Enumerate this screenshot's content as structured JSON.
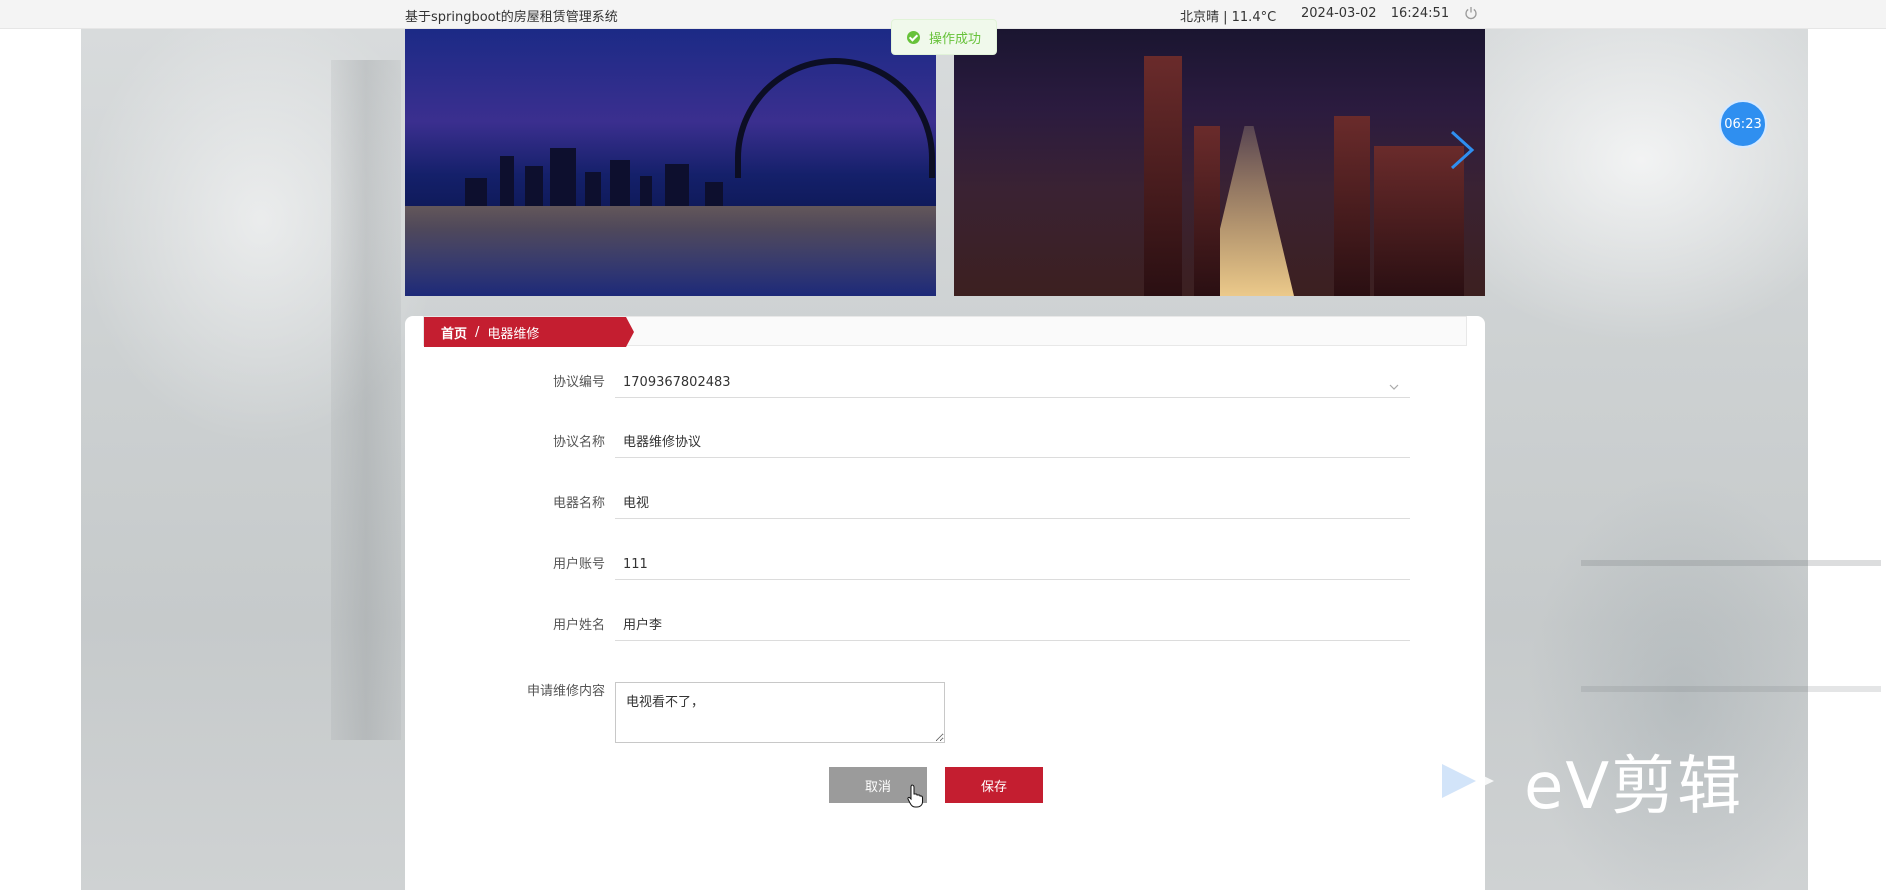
{
  "header": {
    "site_title": "基于springboot的房屋租赁管理系统",
    "weather": "北京晴 | 11.4°C",
    "date": "2024-03-02",
    "time": "16:24:51"
  },
  "toast": {
    "message": "操作成功"
  },
  "timer": {
    "value": "06:23"
  },
  "breadcrumb": {
    "home": "首页",
    "separator": "/",
    "current": "电器维修"
  },
  "form": {
    "agreement_no": {
      "label": "协议编号",
      "value": "1709367802483"
    },
    "agreement_name": {
      "label": "协议名称",
      "value": "电器维修协议"
    },
    "appliance_name": {
      "label": "电器名称",
      "value": "电视"
    },
    "user_account": {
      "label": "用户账号",
      "value": "111"
    },
    "user_name": {
      "label": "用户姓名",
      "value": "用户李"
    },
    "repair_content": {
      "label": "申请维修内容",
      "value": "电视看不了，"
    }
  },
  "buttons": {
    "cancel": "取消",
    "save": "保存"
  },
  "watermark": {
    "text": "eV剪辑"
  },
  "colors": {
    "accent_red": "#c41e30",
    "success_green": "#67c23a",
    "cancel_grey": "#9b9b9b",
    "timer_blue": "#2f8ff0"
  }
}
